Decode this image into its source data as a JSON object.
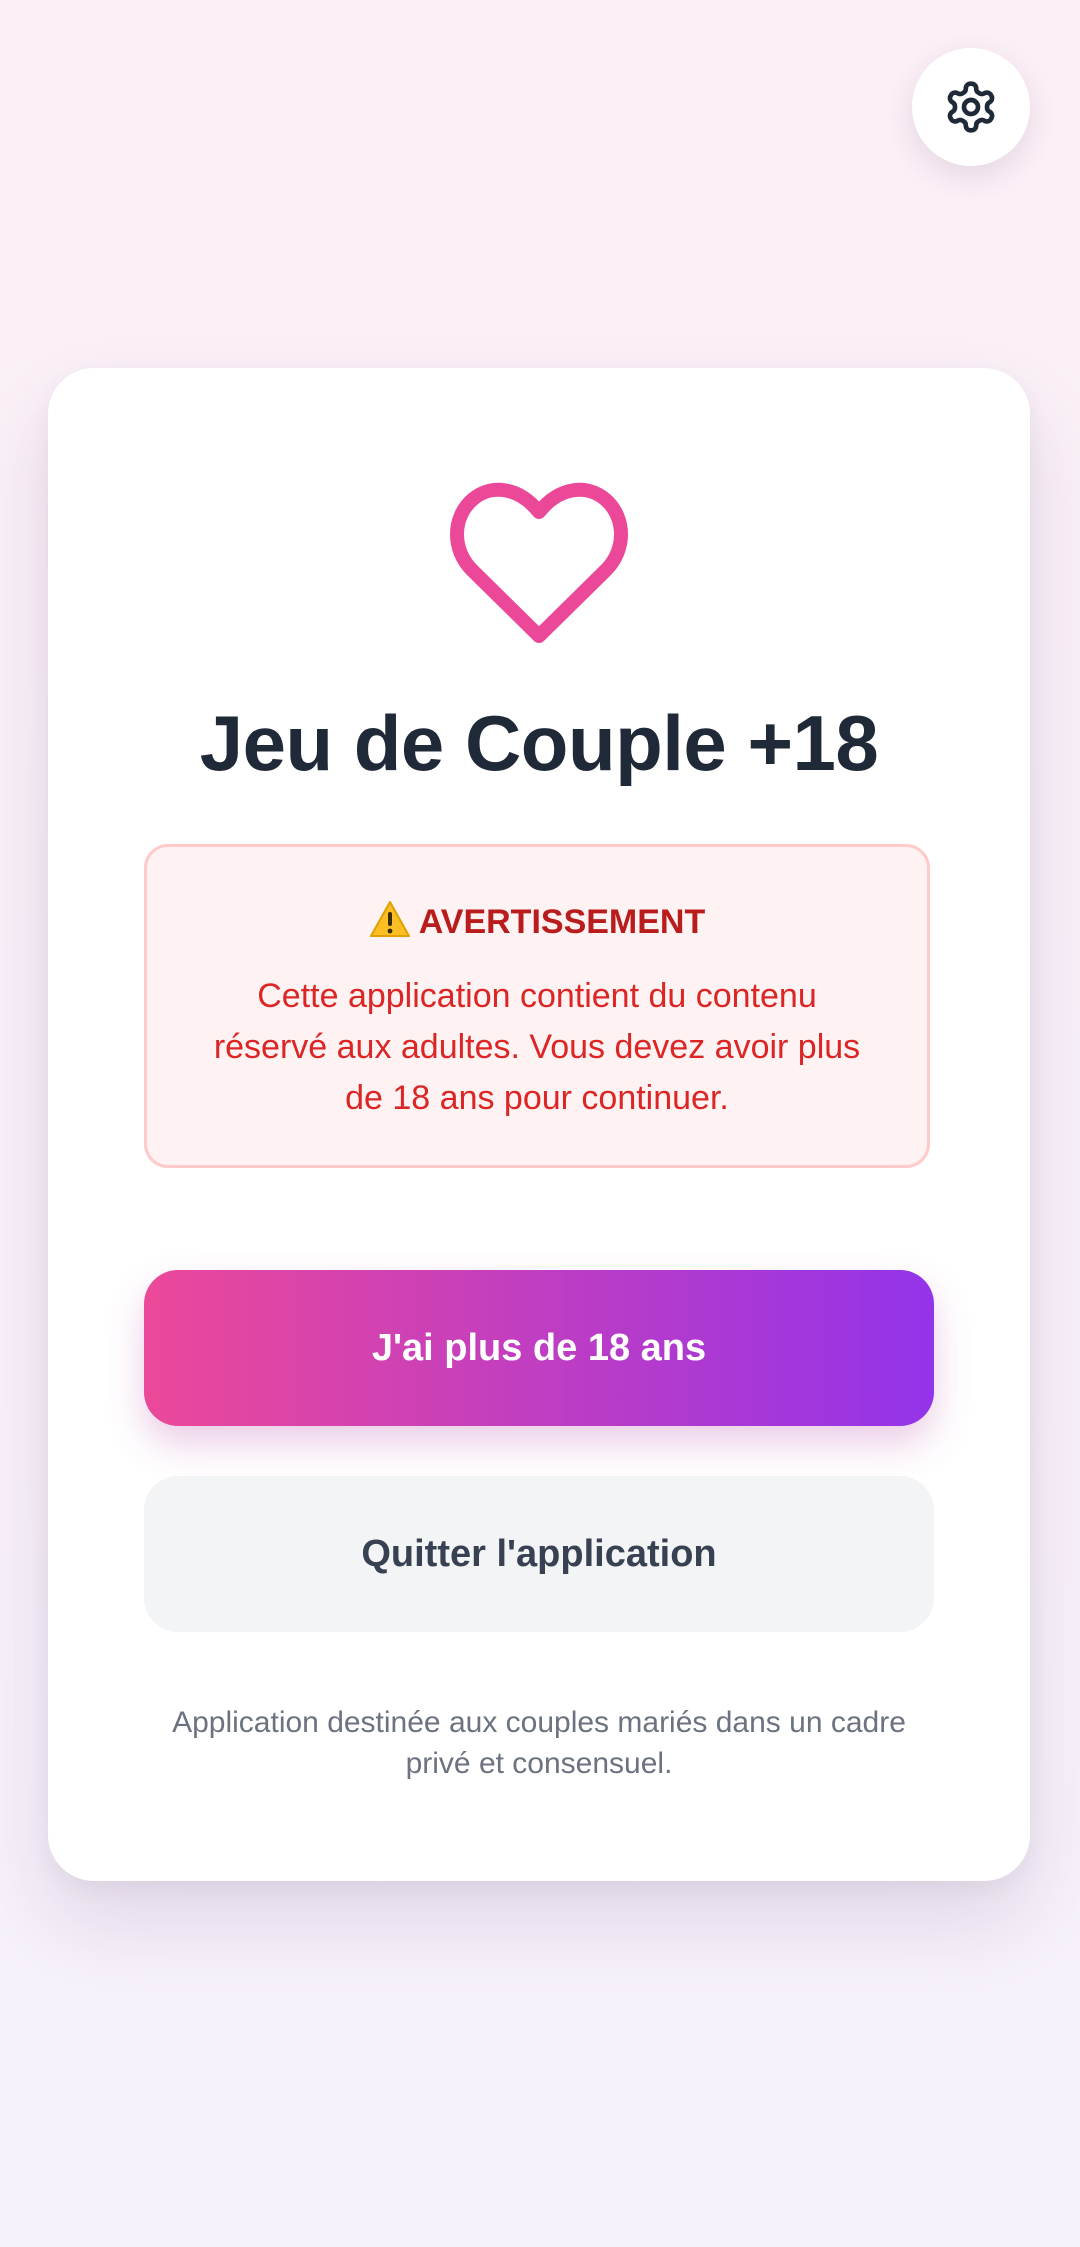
{
  "icons": {
    "settings": "gear-icon",
    "logo": "heart-icon",
    "warning": "warning-icon"
  },
  "colors": {
    "heart": "#ec4899",
    "gradient_start": "#ec4899",
    "gradient_end": "#9333ea",
    "warning_title": "#b91c1c",
    "warning_text": "#dc2626",
    "warning_bg": "#fef2f2",
    "warning_border": "#fecaca"
  },
  "card": {
    "title": "Jeu de Couple +18",
    "warning": {
      "title": "AVERTISSEMENT",
      "text": "Cette application contient du contenu réservé aux adultes. Vous devez avoir plus de 18 ans pour continuer."
    },
    "confirm_button": "J'ai plus de 18 ans",
    "quit_button": "Quitter l'application",
    "footer": "Application destinée aux couples mariés dans un cadre privé et consensuel."
  }
}
